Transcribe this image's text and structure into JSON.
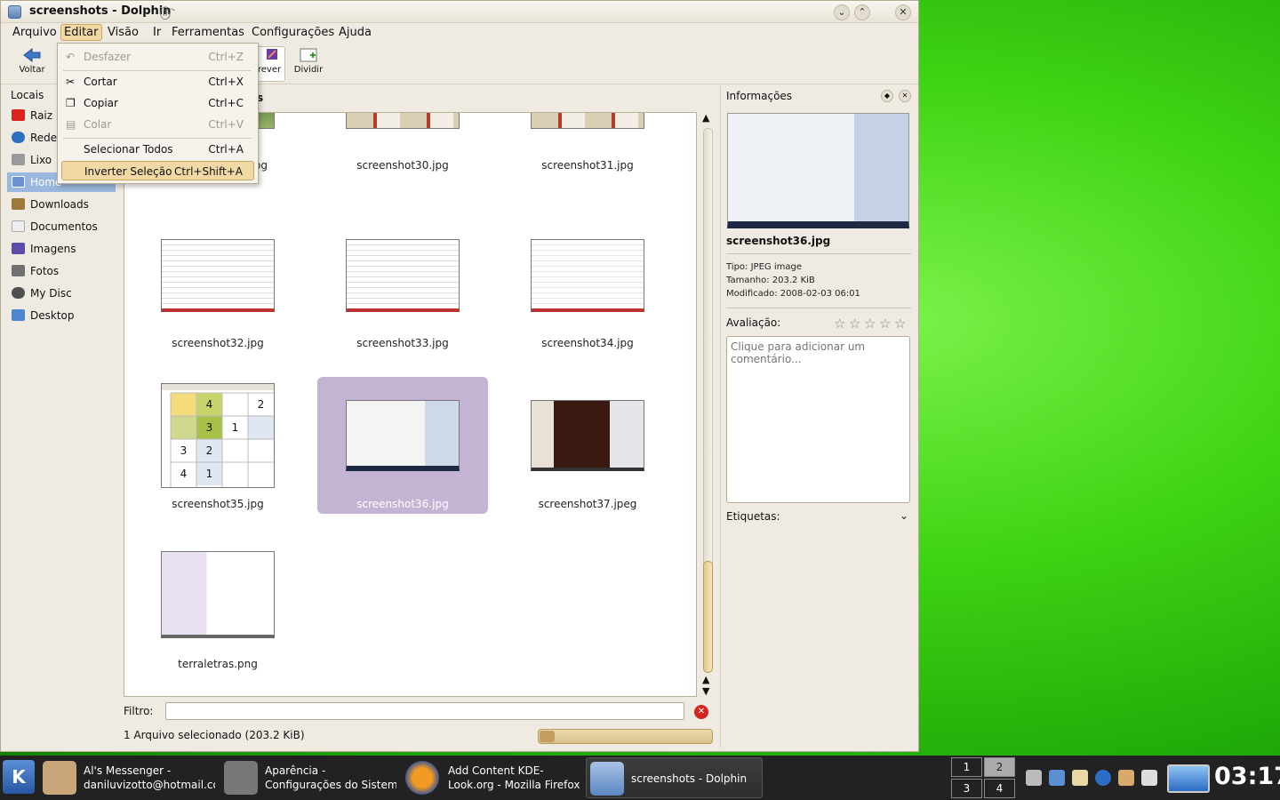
{
  "window": {
    "title": "screenshots - Dolphin",
    "menus": [
      "Arquivo",
      "Editar",
      "Visão",
      "Ir",
      "Ferramentas",
      "Configurações",
      "Ajuda"
    ],
    "active_menu": "Editar"
  },
  "toolbar": {
    "back_label": "Voltar",
    "preview_label": "rever",
    "split_label": "Dividir"
  },
  "edit_menu": {
    "items": [
      {
        "label": "Desfazer",
        "shortcut": "Ctrl+Z",
        "enabled": false,
        "icon": "undo-icon"
      },
      {
        "label": "Cortar",
        "shortcut": "Ctrl+X",
        "enabled": true,
        "icon": "cut-icon"
      },
      {
        "label": "Copiar",
        "shortcut": "Ctrl+C",
        "enabled": true,
        "icon": "copy-icon"
      },
      {
        "label": "Colar",
        "shortcut": "Ctrl+V",
        "enabled": false,
        "icon": "paste-icon"
      },
      {
        "label": "Selecionar Todos",
        "shortcut": "Ctrl+A",
        "enabled": true
      },
      {
        "label": "Inverter Seleção",
        "shortcut": "Ctrl+Shift+A",
        "enabled": true,
        "hovered": true
      }
    ]
  },
  "places": {
    "header": "Locais",
    "items": [
      {
        "label": "Raiz",
        "icon": "root-folder-icon",
        "color": "#d9231c"
      },
      {
        "label": "Rede",
        "icon": "network-globe-icon",
        "color": "#2f6fc2"
      },
      {
        "label": "Lixo",
        "icon": "trash-icon",
        "color": "#9a9a9a"
      },
      {
        "label": "Home",
        "icon": "home-folder-icon",
        "color": "#6b93cf",
        "selected": true
      },
      {
        "label": "Downloads",
        "icon": "downloads-folder-icon",
        "color": "#9b7a3c"
      },
      {
        "label": "Documentos",
        "icon": "documents-icon",
        "color": "#d7d7d7"
      },
      {
        "label": "Imagens",
        "icon": "images-folder-icon",
        "color": "#5a4ca8"
      },
      {
        "label": "Fotos",
        "icon": "camera-icon",
        "color": "#707070"
      },
      {
        "label": "My Disc",
        "icon": "disc-icon",
        "color": "#505050"
      },
      {
        "label": "Desktop",
        "icon": "desktop-folder-icon",
        "color": "#4f86d0"
      }
    ]
  },
  "view": {
    "header": "s",
    "files": [
      {
        "name": "jpg",
        "thumb": "thumb-partial"
      },
      {
        "name": "screenshot30.jpg",
        "thumb": "thumb-window"
      },
      {
        "name": "screenshot31.jpg",
        "thumb": "thumb-window"
      },
      {
        "name": "screenshot32.jpg",
        "thumb": "thumb-table"
      },
      {
        "name": "screenshot33.jpg",
        "thumb": "thumb-table"
      },
      {
        "name": "screenshot34.jpg",
        "thumb": "thumb-table"
      },
      {
        "name": "screenshot35.jpg",
        "thumb": "thumb-sudoku"
      },
      {
        "name": "screenshot36.jpg",
        "thumb": "thumb-messenger",
        "selected": true
      },
      {
        "name": "screenshot37.jpeg",
        "thumb": "thumb-dark"
      },
      {
        "name": "terraletras.png",
        "thumb": "thumb-text"
      }
    ],
    "sudoku_cells": [
      "4",
      "",
      "2",
      "3",
      "1",
      "3",
      "2",
      "4",
      "1"
    ]
  },
  "filter": {
    "label": "Filtro:",
    "value": ""
  },
  "status": {
    "text": "1 Arquivo selecionado (203.2 KiB)"
  },
  "info_panel": {
    "title": "Informações",
    "file_name": "screenshot36.jpg",
    "type_line": "Tipo: JPEG image",
    "size_line": "Tamanho: 203.2 KiB",
    "modified_line": "Modificado: 2008-02-03 06:01",
    "rating_label": "Avaliação:",
    "rating": 0,
    "rating_max": 5,
    "comment_placeholder": "Clique para adicionar um comentário...",
    "tags_label": "Etiquetas:"
  },
  "taskbar": {
    "tasks": [
      {
        "line1": "Al's Messenger -",
        "line2": "daniluvizotto@hotmail.com",
        "icon": "messenger-icon"
      },
      {
        "line1": "Aparência -",
        "line2": "Configurações do Sistema",
        "icon": "tools-icon"
      },
      {
        "line1": "Add Content KDE-",
        "line2": "Look.org - Mozilla Firefox",
        "icon": "firefox-icon"
      },
      {
        "line1": "screenshots - Dolphin",
        "line2": "",
        "icon": "dolphin-icon",
        "active": true
      }
    ],
    "desktops": [
      "1",
      "2",
      "3",
      "4"
    ],
    "current_desktop": "2",
    "clock": "03:17"
  }
}
